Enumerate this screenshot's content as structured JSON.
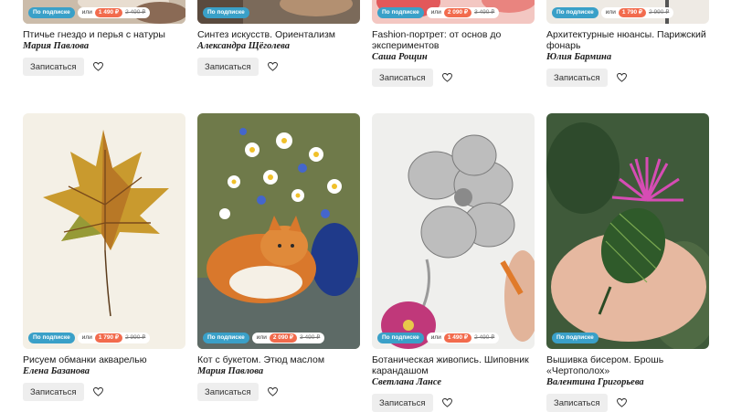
{
  "courses": [
    {
      "title": "Птичье гнездо и перья с натуры",
      "author": "Мария Павлова",
      "subscription": "По подписке",
      "or": "или",
      "price": "1 490 ₽",
      "old_price": "2 490 ₽",
      "enroll": "Записаться",
      "heart_icon": "heart-outline-icon"
    },
    {
      "title": "Синтез искусств. Ориентализм",
      "author": "Александра Щёголева",
      "subscription": "По подписке",
      "enroll": "Записаться",
      "heart_icon": "heart-outline-icon"
    },
    {
      "title": "Fashion-портрет: от основ до экспериментов",
      "author": "Саша Рощин",
      "subscription": "По подписке",
      "or": "или",
      "price": "2 090 ₽",
      "old_price": "3 490 ₽",
      "enroll": "Записаться",
      "heart_icon": "heart-outline-icon"
    },
    {
      "title": "Архитектурные нюансы. Парижский фонарь",
      "author": "Юлия Бармина",
      "subscription": "По подписке",
      "or": "или",
      "price": "1 790 ₽",
      "old_price": "2 990 ₽",
      "enroll": "Записаться",
      "heart_icon": "heart-outline-icon"
    },
    {
      "title": "Рисуем обманки акварелью",
      "author": "Елена Базанова",
      "subscription": "По подписке",
      "or": "или",
      "price": "1 790 ₽",
      "old_price": "2 990 ₽",
      "enroll": "Записаться",
      "heart_icon": "heart-outline-icon"
    },
    {
      "title": "Кот с букетом. Этюд маслом",
      "author": "Мария Павлова",
      "subscription": "По подписке",
      "or": "или",
      "price": "2 090 ₽",
      "old_price": "3 490 ₽",
      "enroll": "Записаться",
      "heart_icon": "heart-outline-icon"
    },
    {
      "title": "Ботаническая живопись. Шиповник карандашом",
      "author": "Светлана Лансе",
      "subscription": "По подписке",
      "or": "или",
      "price": "1 490 ₽",
      "old_price": "2 490 ₽",
      "enroll": "Записаться",
      "heart_icon": "heart-outline-icon"
    },
    {
      "title": "Вышивка бисером. Брошь «Чертополох»",
      "author": "Валентина Григорьева",
      "subscription": "По подписке",
      "enroll": "Записаться",
      "heart_icon": "heart-outline-icon"
    }
  ],
  "colors": {
    "subscription_badge": "#3aa0c8",
    "price_badge": "#f26b4d",
    "button_bg": "#eeeeee"
  }
}
